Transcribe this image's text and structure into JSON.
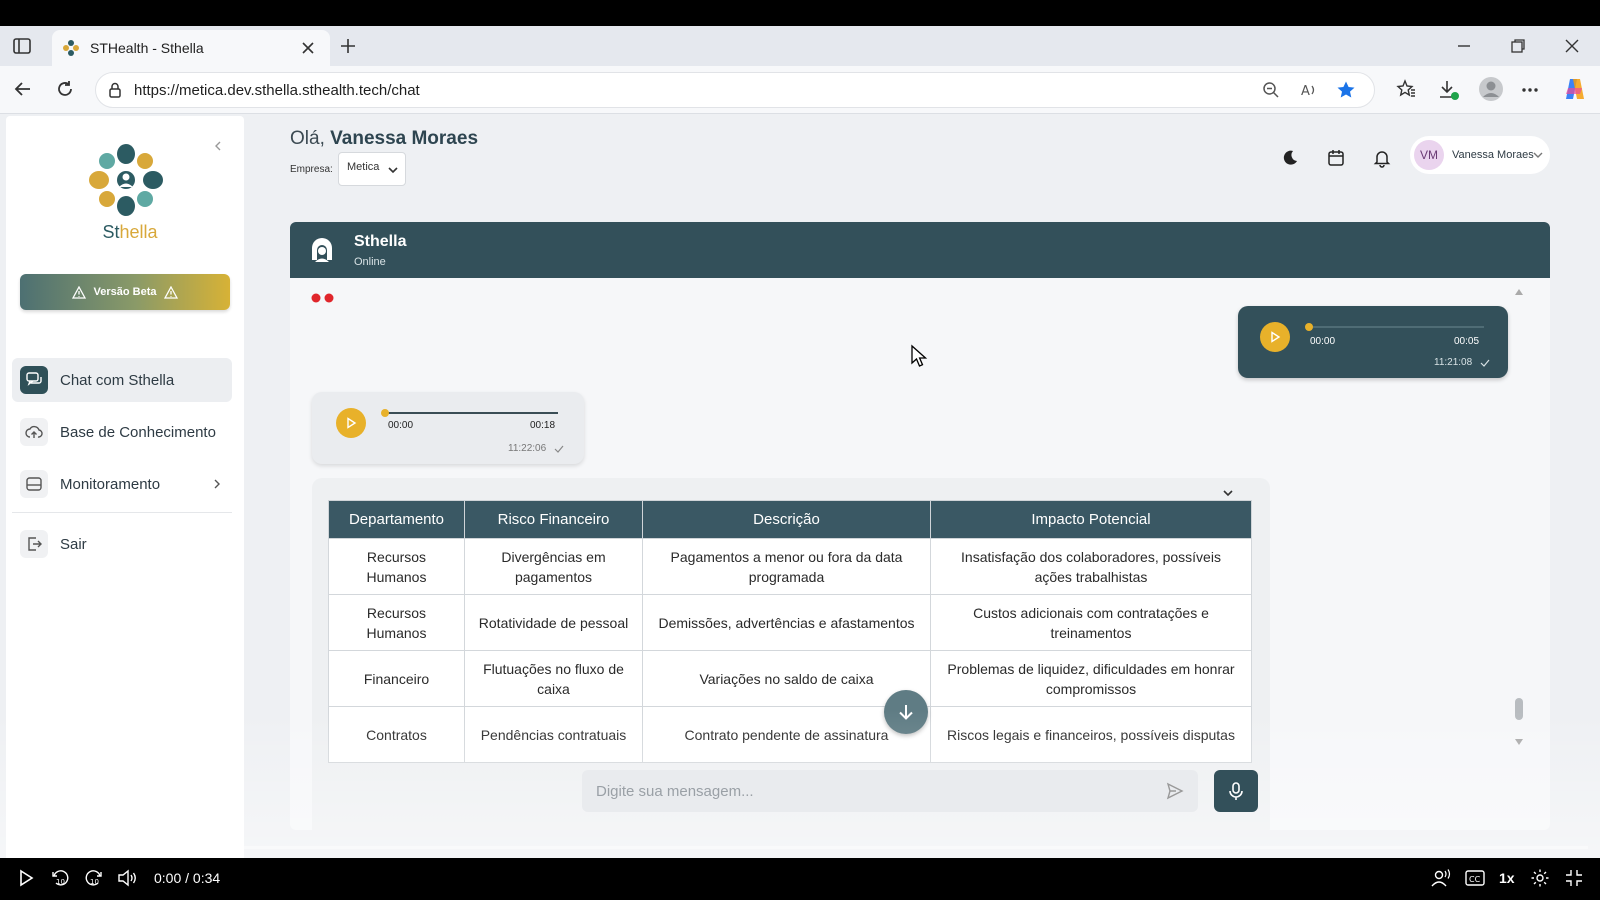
{
  "browser": {
    "tab_title": "STHealth - Sthella",
    "url": "https://metica.dev.sthella.sthealth.tech/chat"
  },
  "sidebar": {
    "logo_name_prefix": "St",
    "logo_name_suffix": "hella",
    "beta_label": "Versão Beta",
    "items": [
      {
        "label": "Chat com Sthella",
        "icon": "chat-icon"
      },
      {
        "label": "Base de Conhecimento",
        "icon": "cloud-upload-icon"
      },
      {
        "label": "Monitoramento",
        "icon": "inbox-icon"
      },
      {
        "label": "Sair",
        "icon": "logout-icon"
      }
    ]
  },
  "header": {
    "greeting_prefix": "Olá,",
    "user_name": "Vanessa Moraes",
    "empresa_label": "Empresa:",
    "empresa_value": "Metica",
    "avatar_initials": "VM",
    "chip_name": "Vanessa Moraes"
  },
  "chat": {
    "bot_name": "Sthella",
    "bot_status": "Online",
    "outgoing_audio": {
      "elapsed": "00:00",
      "duration": "00:05",
      "time": "11:21:08",
      "progress": 0.0
    },
    "incoming_audio": {
      "elapsed": "00:00",
      "duration": "00:18",
      "time": "11:22:06",
      "progress": 0.0
    },
    "table": {
      "headers": [
        "Departamento",
        "Risco Financeiro",
        "Descrição",
        "Impacto Potencial"
      ],
      "rows": [
        [
          "Recursos Humanos",
          "Divergências em pagamentos",
          "Pagamentos a menor ou fora da data programada",
          "Insatisfação dos colaboradores, possíveis ações trabalhistas"
        ],
        [
          "Recursos Humanos",
          "Rotatividade de pessoal",
          "Demissões, advertências e afastamentos",
          "Custos adicionais com contratações e treinamentos"
        ],
        [
          "Financeiro",
          "Flutuações no fluxo de caixa",
          "Variações no saldo de caixa",
          "Problemas de liquidez, dificuldades em honrar compromissos"
        ],
        [
          "Contratos",
          "Pendências contratuais",
          "Contrato pendente de assinatura",
          "Riscos legais e financeiros, possíveis disputas"
        ]
      ]
    },
    "input_placeholder": "Digite sua mensagem..."
  },
  "player": {
    "time": "0:00 / 0:34",
    "speed": "1x",
    "progress": 0.025
  },
  "colors": {
    "primary": "#33505a",
    "accent": "#e8b12a",
    "table_header": "#3a5864"
  }
}
